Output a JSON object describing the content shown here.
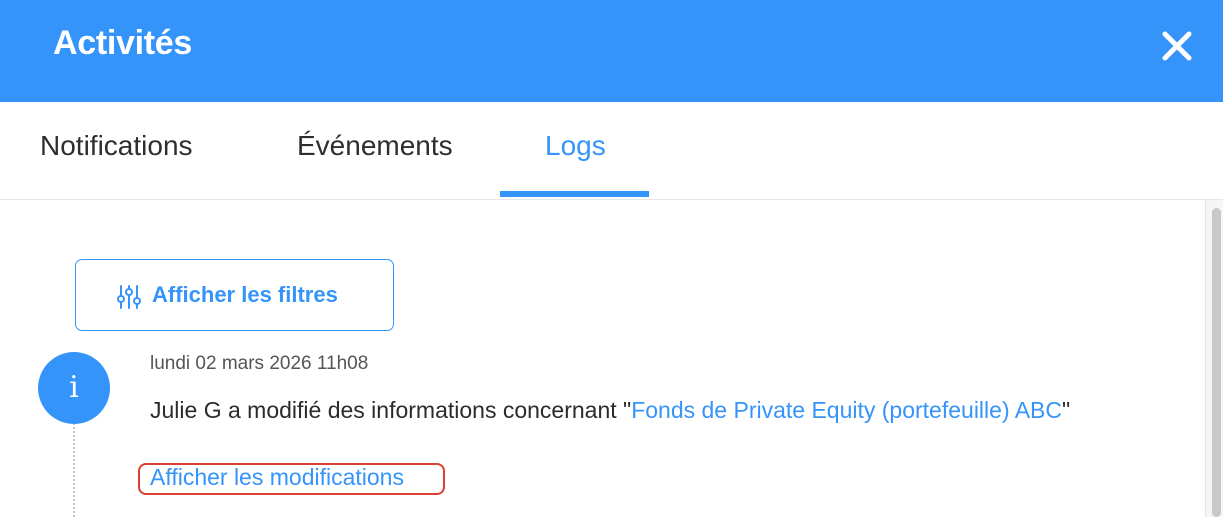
{
  "colors": {
    "primary": "#3594fa",
    "highlight_border": "#d9402f",
    "text": "#2b2b2b"
  },
  "header": {
    "title": "Activités",
    "close_icon": "close-icon"
  },
  "tabs": [
    {
      "label": "Notifications",
      "active": false
    },
    {
      "label": "Événements",
      "active": false
    },
    {
      "label": "Logs",
      "active": true
    }
  ],
  "filters": {
    "button_label": "Afficher les filtres",
    "icon": "sliders-icon"
  },
  "log_entry": {
    "icon": "info-icon",
    "icon_glyph": "i",
    "date": "lundi 02 mars 2026 11h08",
    "text_before": "Julie G a modifié des informations concernant \"",
    "link_text": "Fonds de Private Equity (portefeuille) ABC",
    "text_after": "\"",
    "show_changes_label": "Afficher les modifications"
  }
}
